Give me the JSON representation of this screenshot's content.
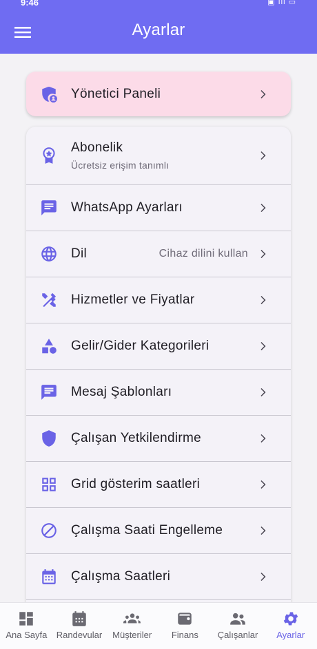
{
  "statusbar": {
    "time": "9:46",
    "system": "▣ ıll ▭"
  },
  "appbar": {
    "title": "Ayarlar"
  },
  "admin": {
    "label": "Yönetici Paneli"
  },
  "settings": [
    {
      "label": "Abonelik",
      "sub": "Ücretsiz erişim tanımlı",
      "icon": "award-icon"
    },
    {
      "label": "WhatsApp Ayarları",
      "icon": "chat-icon"
    },
    {
      "label": "Dil",
      "value": "Cihaz dilini kullan",
      "icon": "globe-icon"
    },
    {
      "label": "Hizmetler ve Fiyatlar",
      "icon": "design-tools-icon"
    },
    {
      "label": "Gelir/Gider Kategorileri",
      "icon": "shapes-icon"
    },
    {
      "label": "Mesaj Şablonları",
      "icon": "message-icon"
    },
    {
      "label": "Çalışan Yetkilendirme",
      "icon": "shield-icon"
    },
    {
      "label": "Grid gösterim saatleri",
      "icon": "grid-icon"
    },
    {
      "label": "Çalışma Saati Engelleme",
      "icon": "block-icon"
    },
    {
      "label": "Çalışma Saatleri",
      "icon": "calendar-icon"
    }
  ],
  "nav": [
    {
      "label": "Ana Sayfa"
    },
    {
      "label": "Randevular"
    },
    {
      "label": "Müşteriler"
    },
    {
      "label": "Finans"
    },
    {
      "label": "Çalışanlar"
    },
    {
      "label": "Ayarlar"
    }
  ],
  "colors": {
    "primary": "#6f6cf2",
    "accent": "#6a63e6",
    "admin_bg": "#fcdbe8"
  }
}
